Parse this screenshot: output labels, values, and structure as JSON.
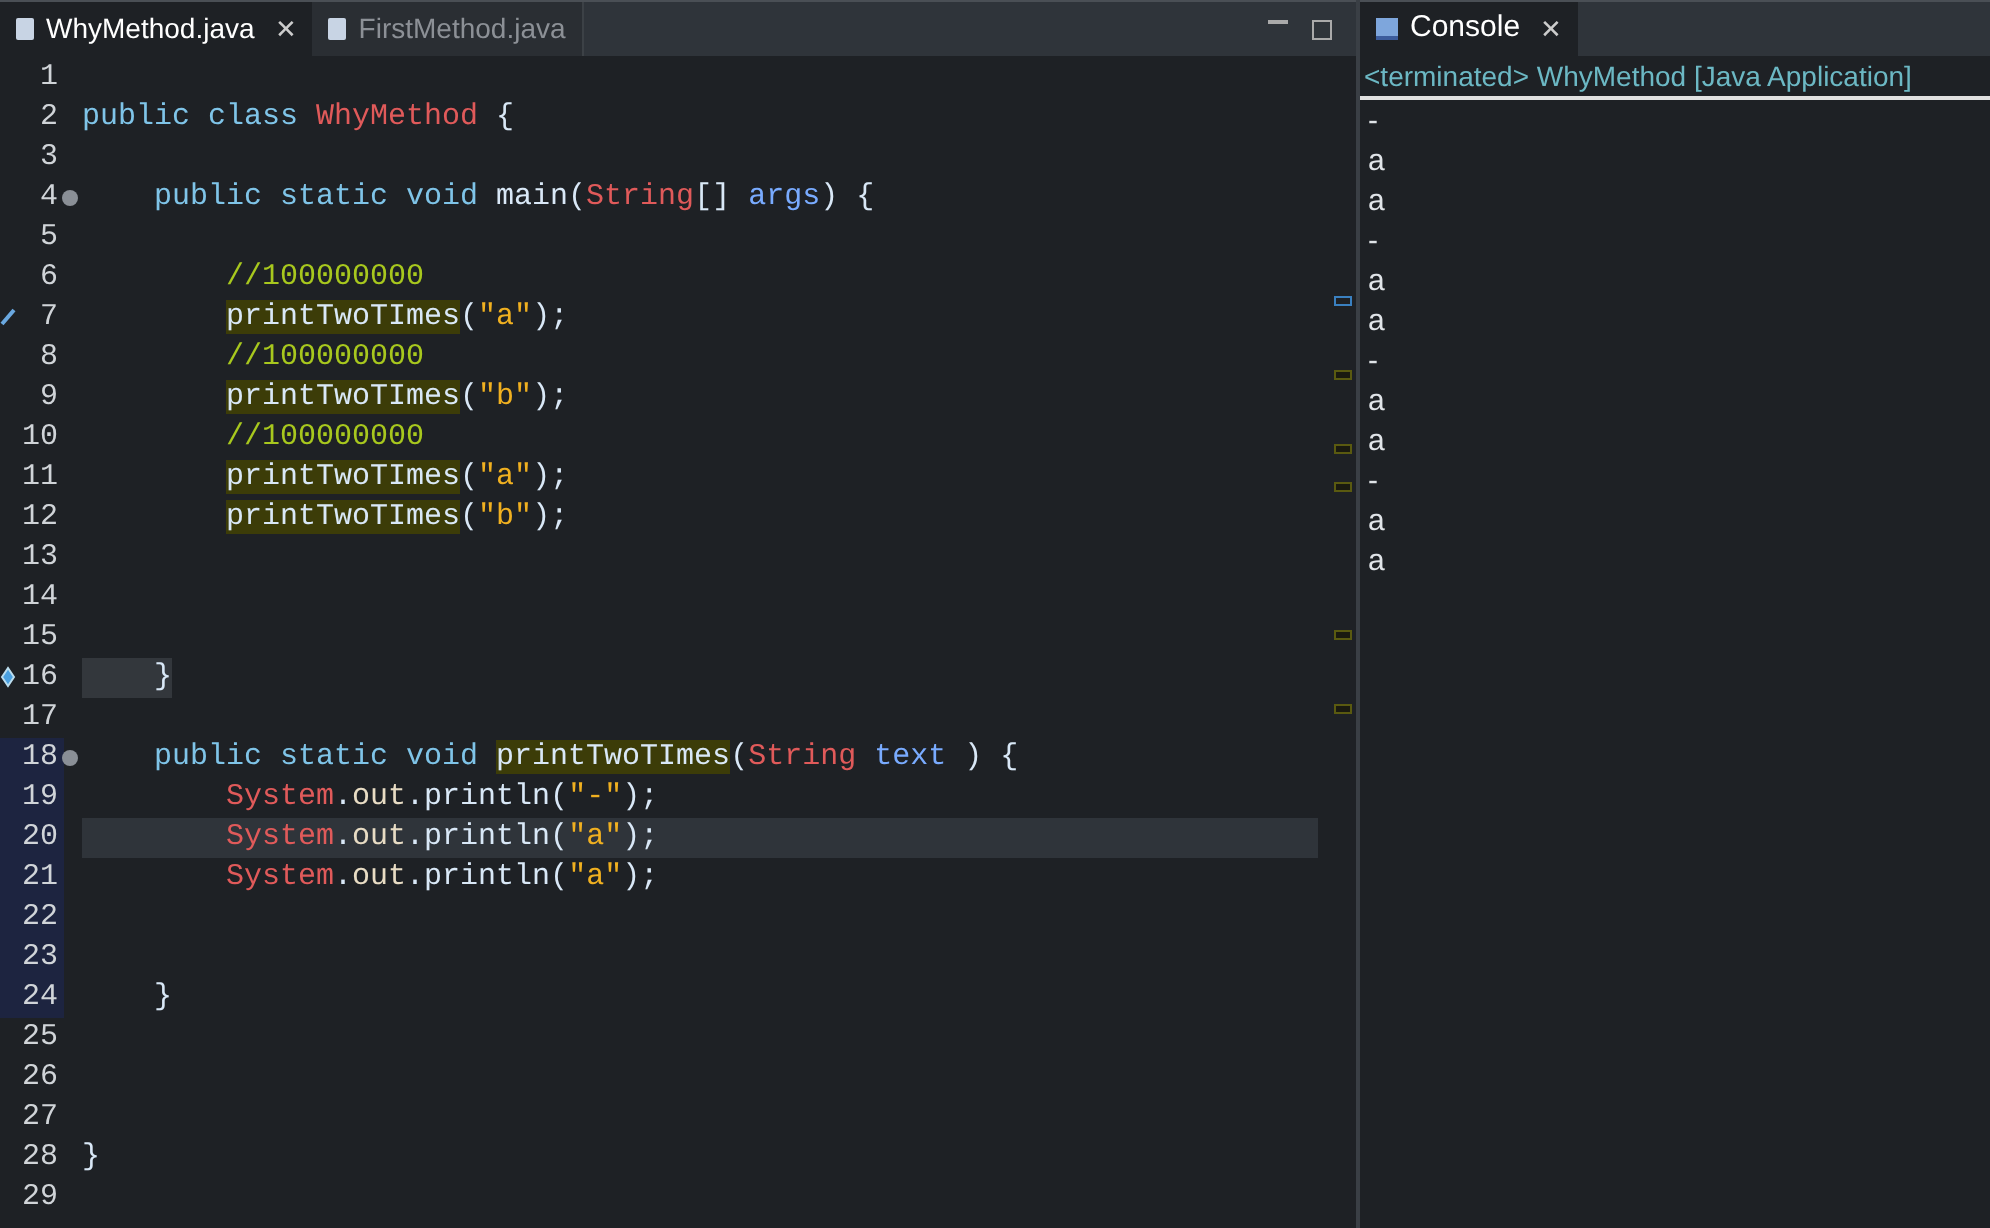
{
  "editor": {
    "tabs": [
      {
        "label": "WhyMethod.java",
        "selected": true,
        "close_glyph": "✕"
      },
      {
        "label": "FirstMethod.java",
        "selected": false
      }
    ],
    "lines": [
      {
        "number": "1",
        "kind": "blank"
      },
      {
        "number": "2",
        "kind": "top",
        "tokens": [
          {
            "kind": "keyword",
            "text": "public class "
          },
          {
            "kind": "type",
            "text": "WhyMethod"
          },
          {
            "kind": "plain",
            "text": " {"
          }
        ]
      },
      {
        "number": "3",
        "kind": "blank"
      },
      {
        "number": "4",
        "marker": {
          "kind": "fold"
        },
        "kind": "member",
        "tokens": [
          {
            "kind": "keyword",
            "text": "public static void "
          },
          {
            "kind": "plain",
            "text": "main("
          },
          {
            "kind": "type",
            "text": "String"
          },
          {
            "kind": "plain",
            "text": "[] "
          },
          {
            "kind": "param",
            "text": "args"
          },
          {
            "kind": "plain",
            "text": ") {"
          }
        ]
      },
      {
        "number": "5",
        "kind": "blank"
      },
      {
        "number": "6",
        "kind": "body",
        "tokens": [
          {
            "kind": "comment",
            "text": "//100000000"
          }
        ]
      },
      {
        "number": "7",
        "marker": {
          "kind": "edit"
        },
        "kind": "body",
        "tokens": [
          {
            "kind": "plain",
            "text": "printTwoTImes",
            "highlighted": true
          },
          {
            "kind": "plain",
            "text": "("
          },
          {
            "kind": "string",
            "text": "\"a\""
          },
          {
            "kind": "plain",
            "text": ");"
          }
        ]
      },
      {
        "number": "8",
        "kind": "body",
        "tokens": [
          {
            "kind": "comment",
            "text": "//100000000"
          }
        ]
      },
      {
        "number": "9",
        "kind": "body",
        "tokens": [
          {
            "kind": "plain",
            "text": "printTwoTImes",
            "highlighted": true
          },
          {
            "kind": "plain",
            "text": "("
          },
          {
            "kind": "string",
            "text": "\"b\""
          },
          {
            "kind": "plain",
            "text": ");"
          }
        ]
      },
      {
        "number": "10",
        "kind": "body",
        "tokens": [
          {
            "kind": "comment",
            "text": "//100000000"
          }
        ]
      },
      {
        "number": "11",
        "kind": "body",
        "tokens": [
          {
            "kind": "plain",
            "text": "printTwoTImes",
            "highlighted": true
          },
          {
            "kind": "plain",
            "text": "("
          },
          {
            "kind": "string",
            "text": "\"a\""
          },
          {
            "kind": "plain",
            "text": ");"
          }
        ]
      },
      {
        "number": "12",
        "kind": "body",
        "tokens": [
          {
            "kind": "plain",
            "text": "printTwoTImes",
            "highlighted": true
          },
          {
            "kind": "plain",
            "text": "("
          },
          {
            "kind": "string",
            "text": "\"b\""
          },
          {
            "kind": "plain",
            "text": ");"
          }
        ]
      },
      {
        "number": "13",
        "kind": "blank"
      },
      {
        "number": "14",
        "kind": "blank"
      },
      {
        "number": "15",
        "kind": "blank"
      },
      {
        "number": "16",
        "marker": {
          "kind": "arrow"
        },
        "kind": "member",
        "boxed": true,
        "tokens": [
          {
            "kind": "plain",
            "text": "}"
          }
        ]
      },
      {
        "number": "17",
        "kind": "blank"
      },
      {
        "number": "18",
        "marker": {
          "kind": "fold"
        },
        "changed": true,
        "kind": "member",
        "tokens": [
          {
            "kind": "keyword",
            "text": "public static void "
          },
          {
            "kind": "plain",
            "text": "printTwoTImes",
            "highlighted": true
          },
          {
            "kind": "plain",
            "text": "("
          },
          {
            "kind": "type",
            "text": "String"
          },
          {
            "kind": "param",
            "text": " text"
          },
          {
            "kind": "plain",
            "text": " ) {"
          }
        ]
      },
      {
        "number": "19",
        "changed": true,
        "kind": "body",
        "tokens": [
          {
            "kind": "type",
            "text": "System"
          },
          {
            "kind": "plain",
            "text": "."
          },
          {
            "kind": "field",
            "text": "out"
          },
          {
            "kind": "plain",
            "text": ".println("
          },
          {
            "kind": "string",
            "text": "\"-\""
          },
          {
            "kind": "plain",
            "text": ");"
          }
        ]
      },
      {
        "number": "20",
        "changed": true,
        "current": true,
        "kind": "body",
        "tokens": [
          {
            "kind": "type",
            "text": "System"
          },
          {
            "kind": "plain",
            "text": "."
          },
          {
            "kind": "field",
            "text": "out"
          },
          {
            "kind": "plain",
            "text": ".println("
          },
          {
            "kind": "string",
            "text": "\"a\""
          },
          {
            "kind": "plain",
            "text": ");"
          }
        ]
      },
      {
        "number": "21",
        "changed": true,
        "kind": "body",
        "tokens": [
          {
            "kind": "type",
            "text": "System"
          },
          {
            "kind": "plain",
            "text": "."
          },
          {
            "kind": "field",
            "text": "out"
          },
          {
            "kind": "plain",
            "text": ".println("
          },
          {
            "kind": "string",
            "text": "\"a\""
          },
          {
            "kind": "plain",
            "text": ");"
          }
        ]
      },
      {
        "number": "22",
        "changed": true,
        "kind": "blank"
      },
      {
        "number": "23",
        "changed": true,
        "kind": "blank"
      },
      {
        "number": "24",
        "changed": true,
        "kind": "member",
        "tokens": [
          {
            "kind": "plain",
            "text": "}"
          }
        ]
      },
      {
        "number": "25",
        "kind": "blank"
      },
      {
        "number": "26",
        "kind": "blank"
      },
      {
        "number": "27",
        "kind": "blank"
      },
      {
        "number": "28",
        "kind": "top",
        "tokens": [
          {
            "kind": "plain",
            "text": "}"
          }
        ]
      },
      {
        "number": "29",
        "kind": "blank"
      }
    ]
  },
  "console": {
    "tab": {
      "label": "Console",
      "selected": true,
      "close_glyph": "✕"
    },
    "status": "<terminated> WhyMethod [Java Application]",
    "output": [
      "-",
      "a",
      "a",
      "-",
      "a",
      "a",
      "-",
      "a",
      "a",
      "-",
      "a",
      "a"
    ]
  }
}
